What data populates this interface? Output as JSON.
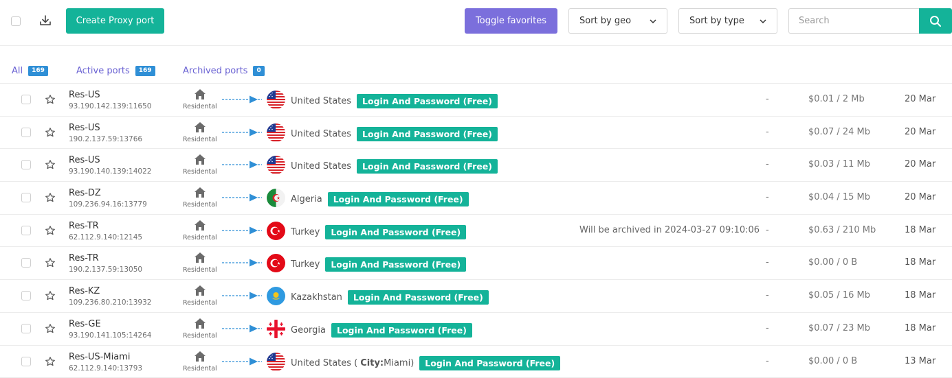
{
  "toolbar": {
    "create_label": "Create Proxy port",
    "favorites_label": "Toggle favorites",
    "sort_geo_label": "Sort by geo",
    "sort_type_label": "Sort by type",
    "search_placeholder": "Search",
    "accent_color": "#14b399",
    "favorites_color": "#7b6fdc"
  },
  "tabs": [
    {
      "label": "All",
      "count": "169"
    },
    {
      "label": "Active ports",
      "count": "169"
    },
    {
      "label": "Archived ports",
      "count": "0"
    }
  ],
  "rows": [
    {
      "name": "Res-US",
      "address": "93.190.142.139:11650",
      "type": "Residental",
      "country": "United States",
      "flag": "us",
      "auth": "Login And Password (Free)",
      "note": "",
      "dash": "-",
      "price": "$0.01 /  2 Mb",
      "date": "20 Mar"
    },
    {
      "name": "Res-US",
      "address": "190.2.137.59:13766",
      "type": "Residental",
      "country": "United States",
      "flag": "us",
      "auth": "Login And Password (Free)",
      "note": "",
      "dash": "-",
      "price": "$0.07 /  24 Mb",
      "date": "20 Mar"
    },
    {
      "name": "Res-US",
      "address": "93.190.140.139:14022",
      "type": "Residental",
      "country": "United States",
      "flag": "us",
      "auth": "Login And Password (Free)",
      "note": "",
      "dash": "-",
      "price": "$0.03 /  11 Mb",
      "date": "20 Mar"
    },
    {
      "name": "Res-DZ",
      "address": "109.236.94.16:13779",
      "type": "Residental",
      "country": "Algeria",
      "flag": "dz",
      "auth": "Login And Password (Free)",
      "note": "",
      "dash": "-",
      "price": "$0.04 /  15 Mb",
      "date": "20 Mar"
    },
    {
      "name": "Res-TR",
      "address": "62.112.9.140:12145",
      "type": "Residental",
      "country": "Turkey",
      "flag": "tr",
      "auth": "Login And Password (Free)",
      "note": "Will be archived in 2024-03-27 09:10:06",
      "dash": "-",
      "price": "$0.63 /  210 Mb",
      "date": "18 Mar"
    },
    {
      "name": "Res-TR",
      "address": "190.2.137.59:13050",
      "type": "Residental",
      "country": "Turkey",
      "flag": "tr",
      "auth": "Login And Password (Free)",
      "note": "",
      "dash": "-",
      "price": "$0.00 /  0 B",
      "date": "18 Mar"
    },
    {
      "name": "Res-KZ",
      "address": "109.236.80.210:13932",
      "type": "Residental",
      "country": "Kazakhstan",
      "flag": "kz",
      "auth": "Login And Password (Free)",
      "note": "",
      "dash": "-",
      "price": "$0.05 /  16 Mb",
      "date": "18 Mar"
    },
    {
      "name": "Res-GE",
      "address": "93.190.141.105:14264",
      "type": "Residental",
      "country": "Georgia",
      "flag": "ge",
      "auth": "Login And Password (Free)",
      "note": "",
      "dash": "-",
      "price": "$0.07 /  23 Mb",
      "date": "18 Mar"
    },
    {
      "name": "Res-US-Miami",
      "address": "62.112.9.140:13793",
      "type": "Residental",
      "country": "United States (",
      "city_key": "City:",
      "city_value": " Miami)",
      "flag": "us",
      "auth": "Login And Password (Free)",
      "note": "",
      "dash": "-",
      "price": "$0.00 /  0 B",
      "date": "13 Mar"
    }
  ]
}
